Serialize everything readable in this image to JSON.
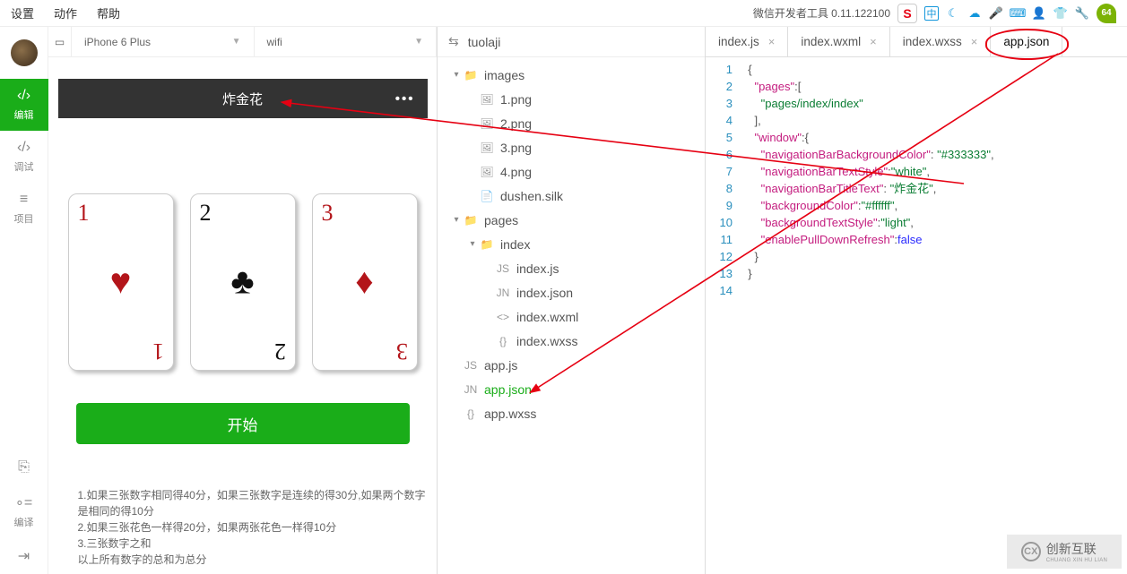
{
  "menu": {
    "settings": "设置",
    "action": "动作",
    "help": "帮助",
    "appTitle": "微信开发者工具 0.11.122100"
  },
  "trayIcons": [
    "sogou-icon",
    "zhong-icon",
    "moon-icon",
    "cloud-icon",
    "mic-icon",
    "keyboard-icon",
    "person-icon",
    "shirt-icon",
    "wrench-icon",
    "sixtyfour-icon"
  ],
  "sidebar": {
    "items": [
      {
        "icon": "‹/›",
        "label": "编辑"
      },
      {
        "icon": "‹/›",
        "label": "调试"
      },
      {
        "icon": "≡",
        "label": "项目"
      }
    ],
    "bottom": [
      {
        "icon": "⎘",
        "label": ""
      },
      {
        "icon": "∘=",
        "label": "编译"
      },
      {
        "icon": "⇥",
        "label": ""
      }
    ]
  },
  "deviceBar": {
    "device": "iPhone 6 Plus",
    "network": "wifi"
  },
  "simulator": {
    "navTitle": "炸金花",
    "cards": [
      {
        "rank": "1",
        "suit": "♥",
        "color": "red"
      },
      {
        "rank": "2",
        "suit": "♣",
        "color": "black"
      },
      {
        "rank": "3",
        "suit": "♦",
        "color": "red"
      }
    ],
    "startLabel": "开始",
    "rules": [
      "1.如果三张数字相同得40分，如果三张数字是连续的得30分,如果两个数字是相同的得10分",
      "2.如果三张花色一样得20分，如果两张花色一样得10分",
      "3.三张数字之和",
      "以上所有数字的总和为总分"
    ]
  },
  "project": {
    "name": "tuolaji"
  },
  "tree": [
    {
      "depth": 0,
      "fold": "▾",
      "icon": "📁",
      "label": "images"
    },
    {
      "depth": 1,
      "icon": "🖼",
      "label": "1.png"
    },
    {
      "depth": 1,
      "icon": "🖼",
      "label": "2.png"
    },
    {
      "depth": 1,
      "icon": "🖼",
      "label": "3.png"
    },
    {
      "depth": 1,
      "icon": "🖼",
      "label": "4.png"
    },
    {
      "depth": 1,
      "icon": "📄",
      "label": "dushen.silk"
    },
    {
      "depth": 0,
      "fold": "▾",
      "icon": "📁",
      "label": "pages"
    },
    {
      "depth": 1,
      "fold": "▾",
      "icon": "📁",
      "label": "index"
    },
    {
      "depth": 2,
      "icon": "JS",
      "label": "index.js"
    },
    {
      "depth": 2,
      "icon": "JN",
      "label": "index.json"
    },
    {
      "depth": 2,
      "icon": "<>",
      "label": "index.wxml"
    },
    {
      "depth": 2,
      "icon": "{}",
      "label": "index.wxss"
    },
    {
      "depth": 0,
      "icon": "JS",
      "label": "app.js"
    },
    {
      "depth": 0,
      "icon": "JN",
      "label": "app.json",
      "sel": true
    },
    {
      "depth": 0,
      "icon": "{}",
      "label": "app.wxss"
    }
  ],
  "editorTabs": [
    {
      "label": "index.js"
    },
    {
      "label": "index.wxml"
    },
    {
      "label": "index.wxss"
    },
    {
      "label": "app.json",
      "active": true,
      "circled": true
    }
  ],
  "code": {
    "lines": [
      1,
      2,
      3,
      4,
      5,
      6,
      7,
      8,
      9,
      10,
      11,
      12,
      13,
      14
    ],
    "json": {
      "pages": [
        "pages/index/index"
      ],
      "window": {
        "navigationBarBackgroundColor": "#333333",
        "navigationBarTextStyle": "white",
        "navigationBarTitleText": "炸金花",
        "backgroundColor": "#ffffff",
        "backgroundTextStyle": "light",
        "enablePullDownRefresh": false
      }
    }
  },
  "watermark": {
    "text": "创新互联",
    "sub": "CHUANG XIN HU LIAN"
  }
}
